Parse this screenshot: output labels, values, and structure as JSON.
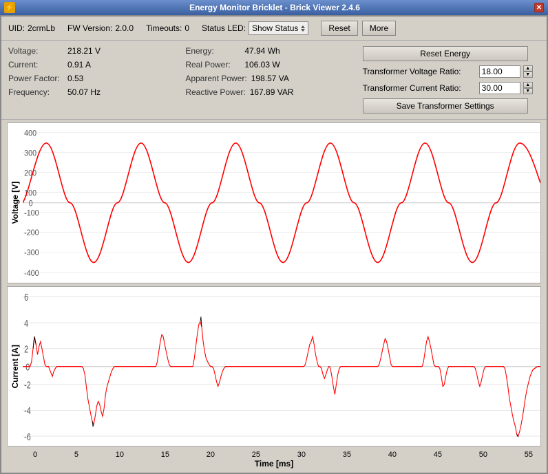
{
  "window": {
    "title": "Energy Monitor Bricklet - Brick Viewer 2.4.6",
    "icon": "⚡"
  },
  "toolbar": {
    "uid_label": "UID:",
    "uid_value": "2crmLb",
    "fw_label": "FW Version:",
    "fw_value": "2.0.0",
    "timeouts_label": "Timeouts:",
    "timeouts_value": "0",
    "status_led_label": "Status LED:",
    "status_led_value": "Show Status",
    "reset_label": "Reset",
    "more_label": "More"
  },
  "info": {
    "voltage_label": "Voltage:",
    "voltage_value": "218.21 V",
    "current_label": "Current:",
    "current_value": "0.91 A",
    "power_factor_label": "Power Factor:",
    "power_factor_value": "0.53",
    "frequency_label": "Frequency:",
    "frequency_value": "50.07 Hz",
    "energy_label": "Energy:",
    "energy_value": "47.94 Wh",
    "real_power_label": "Real Power:",
    "real_power_value": "106.03 W",
    "apparent_power_label": "Apparent Power:",
    "apparent_power_value": "198.57 VA",
    "reactive_power_label": "Reactive Power:",
    "reactive_power_value": "167.89 VAR"
  },
  "right_panel": {
    "reset_energy_label": "Reset Energy",
    "voltage_ratio_label": "Transformer Voltage Ratio:",
    "voltage_ratio_value": "18.00",
    "current_ratio_label": "Transformer Current Ratio:",
    "current_ratio_value": "30.00",
    "save_label": "Save Transformer Settings"
  },
  "voltage_chart": {
    "y_label": "Voltage [V]",
    "y_ticks": [
      "400",
      "300",
      "200",
      "100",
      "0",
      "-100",
      "-200",
      "-300",
      "-400"
    ]
  },
  "current_chart": {
    "y_label": "Current [A]",
    "y_ticks": [
      "6",
      "4",
      "2",
      "0",
      "-2",
      "-4",
      "-6"
    ]
  },
  "x_axis": {
    "label": "Time [ms]",
    "ticks": [
      "0",
      "5",
      "10",
      "15",
      "20",
      "25",
      "30",
      "35",
      "40",
      "45",
      "50",
      "55"
    ]
  }
}
